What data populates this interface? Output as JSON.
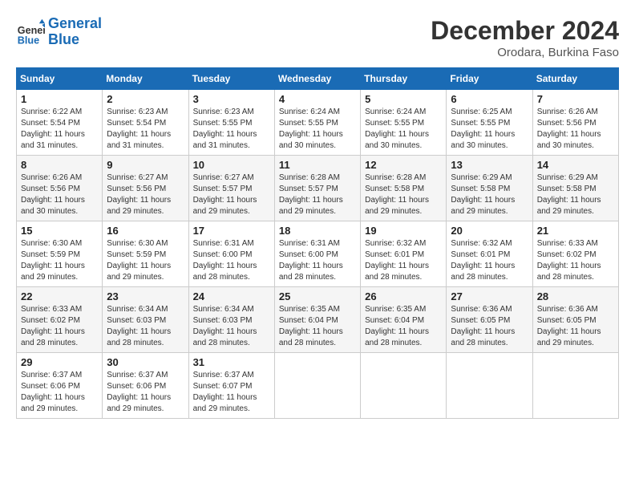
{
  "header": {
    "logo_general": "General",
    "logo_blue": "Blue",
    "month_title": "December 2024",
    "location": "Orodara, Burkina Faso"
  },
  "weekdays": [
    "Sunday",
    "Monday",
    "Tuesday",
    "Wednesday",
    "Thursday",
    "Friday",
    "Saturday"
  ],
  "weeks": [
    [
      {
        "day": "1",
        "sunrise": "6:22 AM",
        "sunset": "5:54 PM",
        "daylight": "11 hours and 31 minutes."
      },
      {
        "day": "2",
        "sunrise": "6:23 AM",
        "sunset": "5:54 PM",
        "daylight": "11 hours and 31 minutes."
      },
      {
        "day": "3",
        "sunrise": "6:23 AM",
        "sunset": "5:55 PM",
        "daylight": "11 hours and 31 minutes."
      },
      {
        "day": "4",
        "sunrise": "6:24 AM",
        "sunset": "5:55 PM",
        "daylight": "11 hours and 30 minutes."
      },
      {
        "day": "5",
        "sunrise": "6:24 AM",
        "sunset": "5:55 PM",
        "daylight": "11 hours and 30 minutes."
      },
      {
        "day": "6",
        "sunrise": "6:25 AM",
        "sunset": "5:55 PM",
        "daylight": "11 hours and 30 minutes."
      },
      {
        "day": "7",
        "sunrise": "6:26 AM",
        "sunset": "5:56 PM",
        "daylight": "11 hours and 30 minutes."
      }
    ],
    [
      {
        "day": "8",
        "sunrise": "6:26 AM",
        "sunset": "5:56 PM",
        "daylight": "11 hours and 30 minutes."
      },
      {
        "day": "9",
        "sunrise": "6:27 AM",
        "sunset": "5:56 PM",
        "daylight": "11 hours and 29 minutes."
      },
      {
        "day": "10",
        "sunrise": "6:27 AM",
        "sunset": "5:57 PM",
        "daylight": "11 hours and 29 minutes."
      },
      {
        "day": "11",
        "sunrise": "6:28 AM",
        "sunset": "5:57 PM",
        "daylight": "11 hours and 29 minutes."
      },
      {
        "day": "12",
        "sunrise": "6:28 AM",
        "sunset": "5:58 PM",
        "daylight": "11 hours and 29 minutes."
      },
      {
        "day": "13",
        "sunrise": "6:29 AM",
        "sunset": "5:58 PM",
        "daylight": "11 hours and 29 minutes."
      },
      {
        "day": "14",
        "sunrise": "6:29 AM",
        "sunset": "5:58 PM",
        "daylight": "11 hours and 29 minutes."
      }
    ],
    [
      {
        "day": "15",
        "sunrise": "6:30 AM",
        "sunset": "5:59 PM",
        "daylight": "11 hours and 29 minutes."
      },
      {
        "day": "16",
        "sunrise": "6:30 AM",
        "sunset": "5:59 PM",
        "daylight": "11 hours and 29 minutes."
      },
      {
        "day": "17",
        "sunrise": "6:31 AM",
        "sunset": "6:00 PM",
        "daylight": "11 hours and 28 minutes."
      },
      {
        "day": "18",
        "sunrise": "6:31 AM",
        "sunset": "6:00 PM",
        "daylight": "11 hours and 28 minutes."
      },
      {
        "day": "19",
        "sunrise": "6:32 AM",
        "sunset": "6:01 PM",
        "daylight": "11 hours and 28 minutes."
      },
      {
        "day": "20",
        "sunrise": "6:32 AM",
        "sunset": "6:01 PM",
        "daylight": "11 hours and 28 minutes."
      },
      {
        "day": "21",
        "sunrise": "6:33 AM",
        "sunset": "6:02 PM",
        "daylight": "11 hours and 28 minutes."
      }
    ],
    [
      {
        "day": "22",
        "sunrise": "6:33 AM",
        "sunset": "6:02 PM",
        "daylight": "11 hours and 28 minutes."
      },
      {
        "day": "23",
        "sunrise": "6:34 AM",
        "sunset": "6:03 PM",
        "daylight": "11 hours and 28 minutes."
      },
      {
        "day": "24",
        "sunrise": "6:34 AM",
        "sunset": "6:03 PM",
        "daylight": "11 hours and 28 minutes."
      },
      {
        "day": "25",
        "sunrise": "6:35 AM",
        "sunset": "6:04 PM",
        "daylight": "11 hours and 28 minutes."
      },
      {
        "day": "26",
        "sunrise": "6:35 AM",
        "sunset": "6:04 PM",
        "daylight": "11 hours and 28 minutes."
      },
      {
        "day": "27",
        "sunrise": "6:36 AM",
        "sunset": "6:05 PM",
        "daylight": "11 hours and 28 minutes."
      },
      {
        "day": "28",
        "sunrise": "6:36 AM",
        "sunset": "6:05 PM",
        "daylight": "11 hours and 29 minutes."
      }
    ],
    [
      {
        "day": "29",
        "sunrise": "6:37 AM",
        "sunset": "6:06 PM",
        "daylight": "11 hours and 29 minutes."
      },
      {
        "day": "30",
        "sunrise": "6:37 AM",
        "sunset": "6:06 PM",
        "daylight": "11 hours and 29 minutes."
      },
      {
        "day": "31",
        "sunrise": "6:37 AM",
        "sunset": "6:07 PM",
        "daylight": "11 hours and 29 minutes."
      },
      null,
      null,
      null,
      null
    ]
  ],
  "labels": {
    "sunrise": "Sunrise:",
    "sunset": "Sunset:",
    "daylight": "Daylight:"
  }
}
